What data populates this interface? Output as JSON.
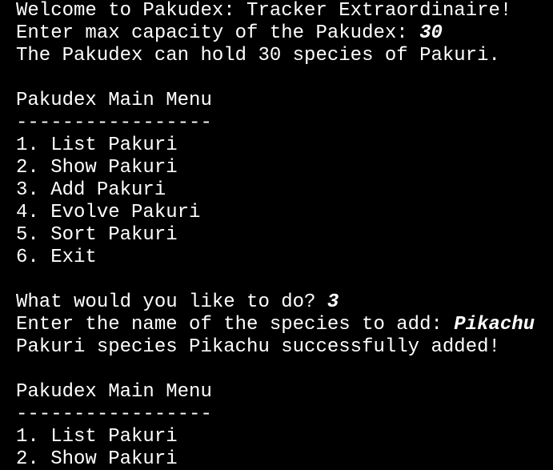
{
  "colors": {
    "background": "#000000",
    "text": "#ffffff"
  },
  "terminal": {
    "welcome": "Welcome to Pakudex: Tracker Extraordinaire!",
    "capacity_prompt": "Enter max capacity of the Pakudex: ",
    "capacity_input": "30",
    "capacity_confirm": "The Pakudex can hold 30 species of Pakuri.",
    "menu1": {
      "title": "Pakudex Main Menu",
      "divider": "-----------------",
      "items": [
        "1. List Pakuri",
        "2. Show Pakuri",
        "3. Add Pakuri",
        "4. Evolve Pakuri",
        "5. Sort Pakuri",
        "6. Exit"
      ]
    },
    "action_prompt": "What would you like to do? ",
    "action_input": "3",
    "species_prompt": "Enter the name of the species to add: ",
    "species_input": "Pikachu",
    "species_confirm": "Pakuri species Pikachu successfully added!",
    "menu2": {
      "title": "Pakudex Main Menu",
      "divider": "-----------------",
      "items": [
        "1. List Pakuri",
        "2. Show Pakuri"
      ]
    }
  }
}
